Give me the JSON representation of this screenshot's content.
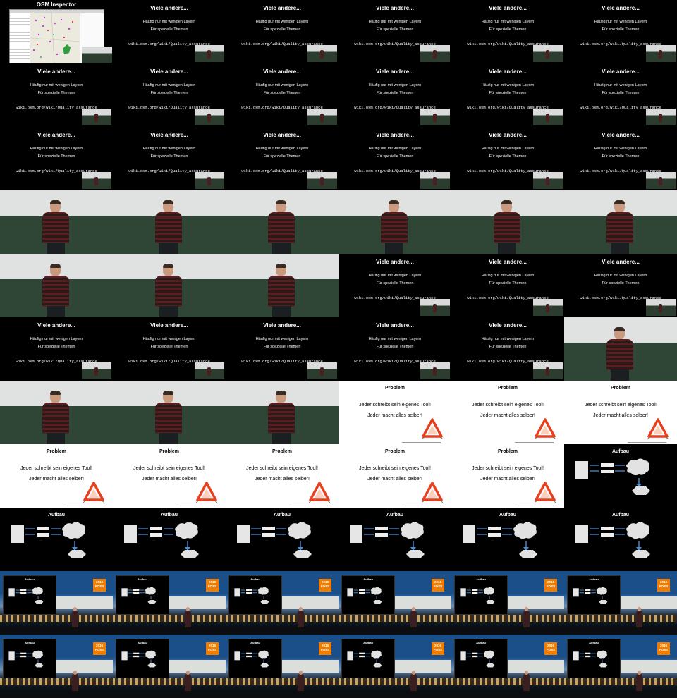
{
  "slides": {
    "osm": {
      "title": "OSM Inspector"
    },
    "andere": {
      "title": "Viele andere...",
      "line1": "Häufig nur mit wenigen Layern",
      "line2": "Für spezielle Themen",
      "url": "wiki.osm.org/wiki/Quality_assurance"
    },
    "problem": {
      "title": "Problem",
      "line1": "Jeder schreibt sein eigenes Tool!",
      "line2": "Jeder macht alles selber!"
    },
    "aufbau": {
      "title": "Aufbau"
    },
    "logo": {
      "line1": "2016",
      "line2": "FOSS"
    }
  },
  "grid": {
    "columns": 6,
    "rows": 11,
    "tiles": [
      "osm",
      "andere",
      "andere",
      "andere",
      "andere",
      "andere",
      "andere",
      "andere",
      "andere",
      "andere",
      "andere",
      "andere",
      "andere",
      "andere",
      "andere",
      "andere",
      "andere",
      "andere",
      "cam",
      "cam",
      "cam",
      "cam",
      "cam",
      "cam",
      "cam",
      "cam",
      "cam",
      "andere",
      "andere",
      "andere",
      "andere",
      "andere",
      "andere",
      "andere",
      "andere",
      "cam",
      "cam",
      "cam",
      "cam",
      "problem",
      "problem",
      "problem",
      "problem",
      "problem",
      "problem",
      "problem",
      "problem",
      "aufbau",
      "aufbau",
      "aufbau",
      "aufbau",
      "aufbau",
      "aufbau",
      "aufbau",
      "venue",
      "venue",
      "venue",
      "venue",
      "venue",
      "venue",
      "venue",
      "venue",
      "venue",
      "venue",
      "venue",
      "venue"
    ]
  }
}
